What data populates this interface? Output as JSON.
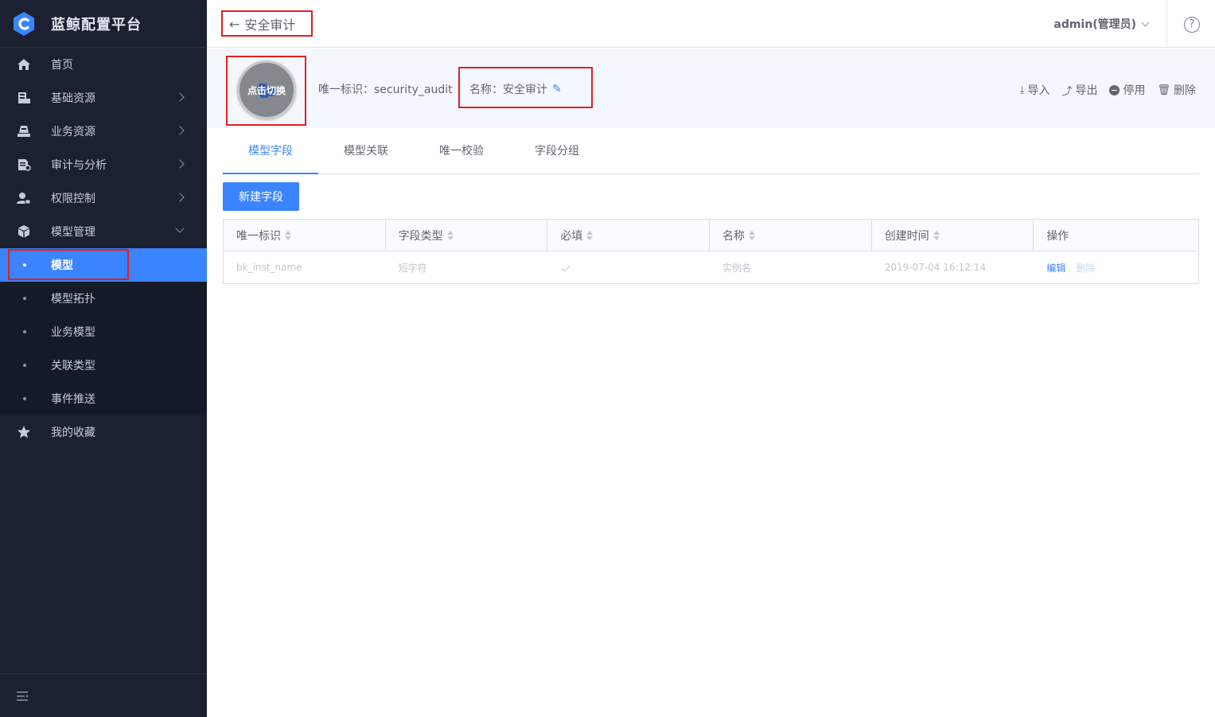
{
  "app": {
    "title": "蓝鲸配置平台"
  },
  "sidebar": {
    "items": [
      {
        "label": "首页",
        "icon": "home-icon"
      },
      {
        "label": "基础资源",
        "icon": "server-icon"
      },
      {
        "label": "业务资源",
        "icon": "business-icon"
      },
      {
        "label": "审计与分析",
        "icon": "audit-icon"
      },
      {
        "label": "权限控制",
        "icon": "user-lock-icon"
      },
      {
        "label": "模型管理",
        "icon": "cube-icon"
      }
    ],
    "model_subitems": [
      {
        "label": "模型",
        "active": true
      },
      {
        "label": "模型拓扑"
      },
      {
        "label": "业务模型"
      },
      {
        "label": "关联类型"
      },
      {
        "label": "事件推送"
      }
    ],
    "favorites": {
      "label": "我的收藏",
      "icon": "star-icon"
    }
  },
  "header": {
    "back_label": "安全审计",
    "user": "admin(管理员)",
    "help": "?"
  },
  "model": {
    "avatar_hint": "点击切换",
    "id_label": "唯一标识：security_audit",
    "name_label": "名称：安全审计"
  },
  "actions": {
    "import": "导入",
    "export": "导出",
    "disable": "停用",
    "delete": "删除"
  },
  "tabs": [
    "模型字段",
    "模型关联",
    "唯一校验",
    "字段分组"
  ],
  "new_field_button": "新建字段",
  "table": {
    "headers": [
      "唯一标识",
      "字段类型",
      "必填",
      "名称",
      "创建时间",
      "操作"
    ],
    "rows": [
      {
        "id": "bk_inst_name",
        "type": "短字符",
        "required": true,
        "name": "实例名",
        "created": "2019-07-04 16:12:14",
        "edit": "编辑",
        "delete": "删除"
      }
    ]
  },
  "colors": {
    "sidebar_bg": "#1c2131",
    "accent": "#3a84ff",
    "highlight_box": "#e02020"
  }
}
